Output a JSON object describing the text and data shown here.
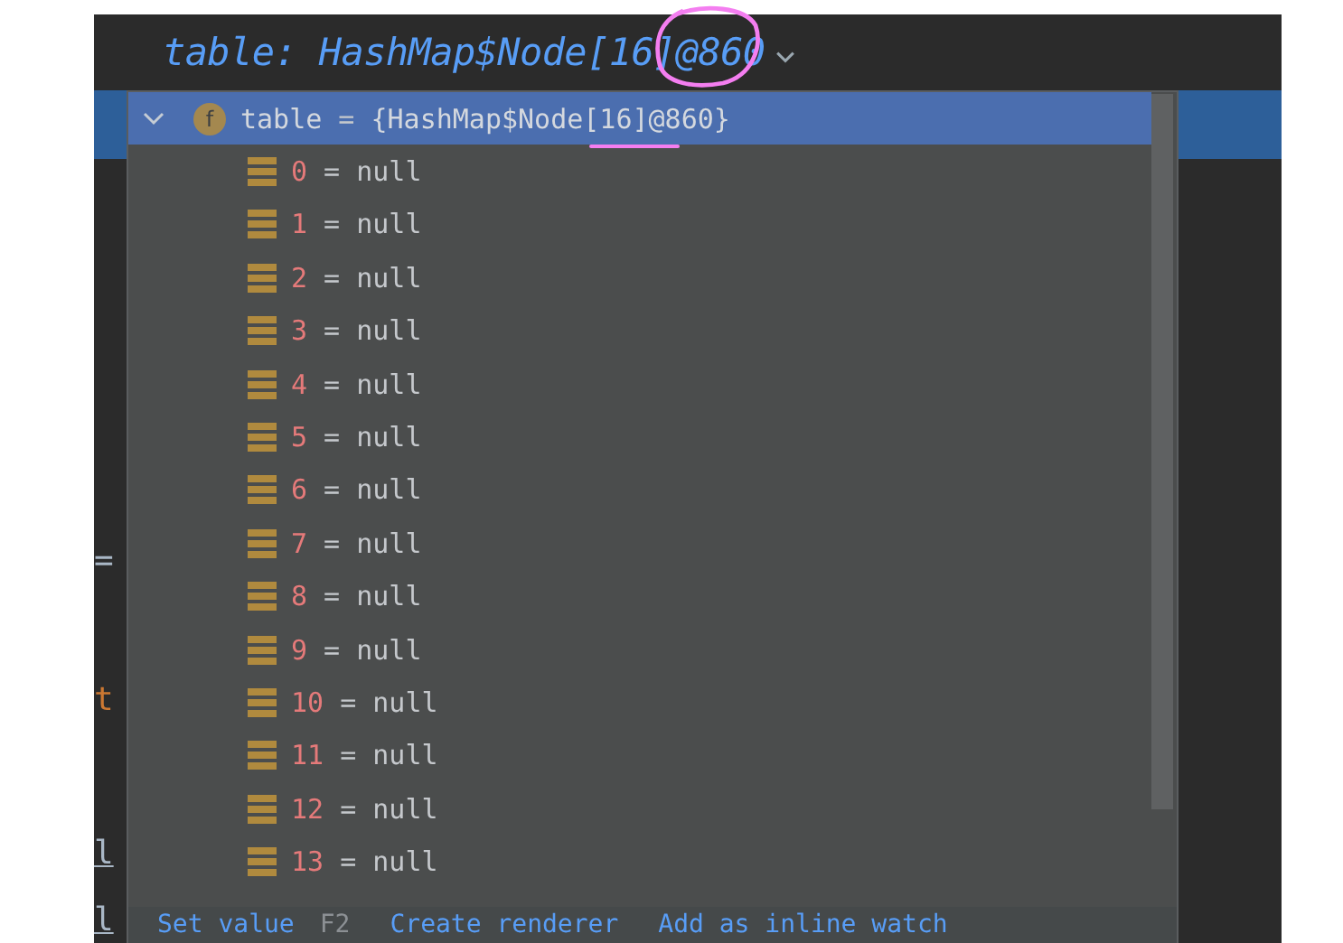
{
  "editor": {
    "title": "table: HashMap$Node[16]@860",
    "gutter": [
      {
        "text": "=",
        "kind": "plain"
      },
      {
        "text": "t",
        "kind": "keyword"
      },
      {
        "text": "l",
        "kind": "underlined"
      },
      {
        "text": "l",
        "kind": "underlined"
      }
    ]
  },
  "popup": {
    "root": {
      "icon": "f",
      "name": "table",
      "separator": "=",
      "value": "{HashMap$Node[16]@860}",
      "expanded": true,
      "selected": true,
      "children": [
        {
          "index": "0",
          "separator": "=",
          "value": "null"
        },
        {
          "index": "1",
          "separator": "=",
          "value": "null"
        },
        {
          "index": "2",
          "separator": "=",
          "value": "null"
        },
        {
          "index": "3",
          "separator": "=",
          "value": "null"
        },
        {
          "index": "4",
          "separator": "=",
          "value": "null"
        },
        {
          "index": "5",
          "separator": "=",
          "value": "null"
        },
        {
          "index": "6",
          "separator": "=",
          "value": "null"
        },
        {
          "index": "7",
          "separator": "=",
          "value": "null"
        },
        {
          "index": "8",
          "separator": "=",
          "value": "null"
        },
        {
          "index": "9",
          "separator": "=",
          "value": "null"
        },
        {
          "index": "10",
          "separator": "=",
          "value": "null"
        },
        {
          "index": "11",
          "separator": "=",
          "value": "null"
        },
        {
          "index": "12",
          "separator": "=",
          "value": "null"
        },
        {
          "index": "13",
          "separator": "=",
          "value": "null"
        }
      ]
    },
    "actions": [
      {
        "label": "Set value",
        "shortcut": "F2"
      },
      {
        "label": "Create renderer"
      },
      {
        "label": "Add as inline watch"
      }
    ]
  }
}
